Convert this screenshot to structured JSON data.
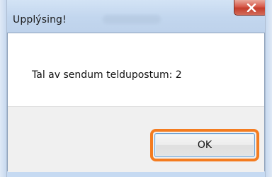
{
  "dialog": {
    "title": "Upplýsing!",
    "message": "Tal av sendum teldupostum: 2",
    "ok_label": "OK",
    "close_icon": "close-icon"
  },
  "colors": {
    "highlight": "#f47c20",
    "close_button": "#c9473a",
    "titlebar": "#c6daf2"
  }
}
